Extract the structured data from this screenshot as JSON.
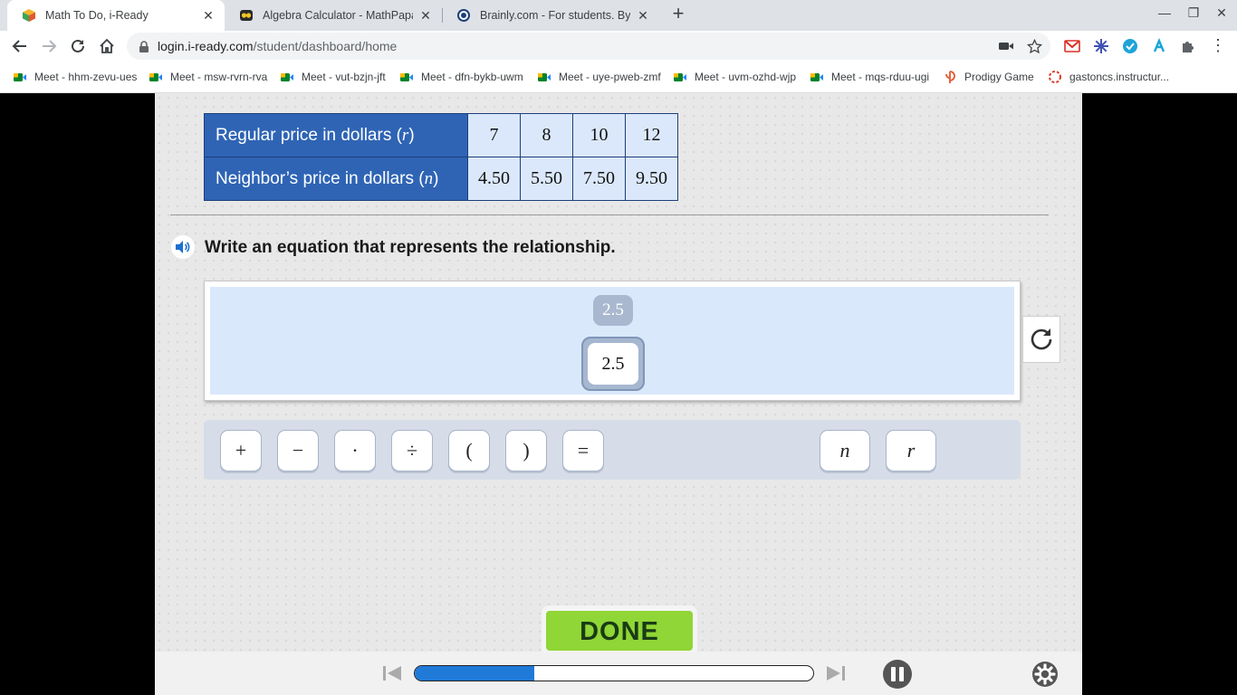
{
  "browser": {
    "tabs": [
      {
        "title": "Math To Do, i-Ready",
        "active": true,
        "icon": "iready-cube-icon"
      },
      {
        "title": "Algebra Calculator - MathPapa",
        "active": false,
        "icon": "mathpapa-icon"
      },
      {
        "title": "Brainly.com - For students. By st",
        "active": false,
        "icon": "brainly-icon"
      }
    ],
    "url_host": "login.i-ready.com",
    "url_path": "/student/dashboard/home",
    "bookmarks": [
      {
        "label": "Meet - hhm-zevu-ues",
        "icon": "google-meet-icon"
      },
      {
        "label": "Meet - msw-rvrn-rva",
        "icon": "google-meet-icon"
      },
      {
        "label": "Meet - vut-bzjn-jft",
        "icon": "google-meet-icon"
      },
      {
        "label": "Meet - dfn-bykb-uwm",
        "icon": "google-meet-icon"
      },
      {
        "label": "Meet - uye-pweb-zmf",
        "icon": "google-meet-icon"
      },
      {
        "label": "Meet - uvm-ozhd-wjp",
        "icon": "google-meet-icon"
      },
      {
        "label": "Meet - mqs-rduu-ugi",
        "icon": "google-meet-icon"
      },
      {
        "label": "Prodigy Game",
        "icon": "prodigy-icon"
      },
      {
        "label": "gastoncs.instructur...",
        "icon": "canvas-icon"
      }
    ]
  },
  "lesson": {
    "table": {
      "row1_label": "Regular price in dollars (",
      "row1_var": "r",
      "row2_label": "Neighbor’s price in dollars (",
      "row2_var": "n",
      "close_paren": ")",
      "row1_values": [
        "7",
        "8",
        "10",
        "12"
      ],
      "row2_values": [
        "4.50",
        "5.50",
        "7.50",
        "9.50"
      ]
    },
    "prompt": "Write an equation that represents the relationship.",
    "ghost_tile": "2.5",
    "answer_tile": "2.5",
    "keypad": {
      "operators": [
        "+",
        "−",
        "·",
        "÷",
        "(",
        ")",
        "="
      ],
      "variables": [
        "n",
        "r"
      ]
    },
    "done_label": "DONE",
    "progress_fraction": 0.3
  },
  "colors": {
    "table_header": "#2f64b5",
    "table_cell": "#dbe8fb",
    "done_button": "#8fd636",
    "progress_fill": "#1f7ad8"
  }
}
